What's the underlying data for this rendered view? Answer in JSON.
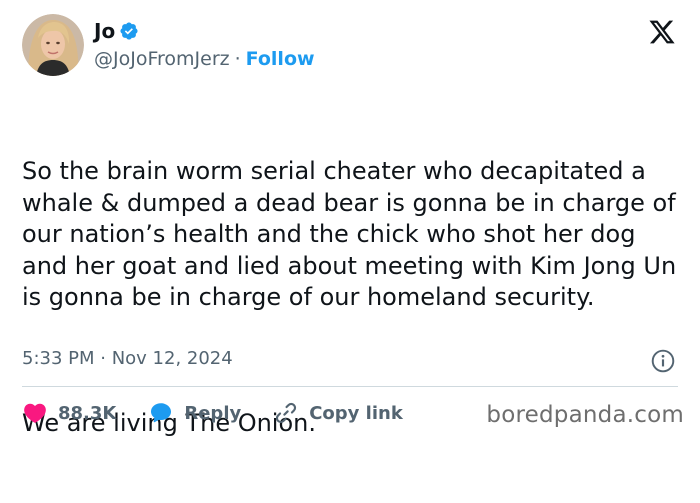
{
  "author": {
    "name": "Jo",
    "handle": "@JoJoFromJerz",
    "separator": "·",
    "follow_label": "Follow"
  },
  "tweet": {
    "text": "So the brain worm serial cheater who decapitated a whale & dumped a dead bear is gonna be in charge of our nation’s health and the chick who shot her dog and her goat and lied about meeting with Kim Jong Un is gonna be in charge of our homeland security.",
    "text_2": "We are living The Onion.",
    "timestamp": "5:33 PM · Nov 12, 2024"
  },
  "actions": {
    "likes": "88.3K",
    "reply_label": "Reply",
    "copy_link_label": "Copy link"
  },
  "watermark": "boredpanda.com",
  "colors": {
    "accent": "#1d9bf0",
    "like": "#f91880",
    "text": "#0f1419",
    "muted": "#536471"
  },
  "icons": {
    "verified": "verified-badge-icon",
    "logo": "x-logo-icon",
    "info": "info-icon",
    "like": "heart-icon",
    "reply": "speech-bubble-icon",
    "copy_link": "link-icon"
  }
}
